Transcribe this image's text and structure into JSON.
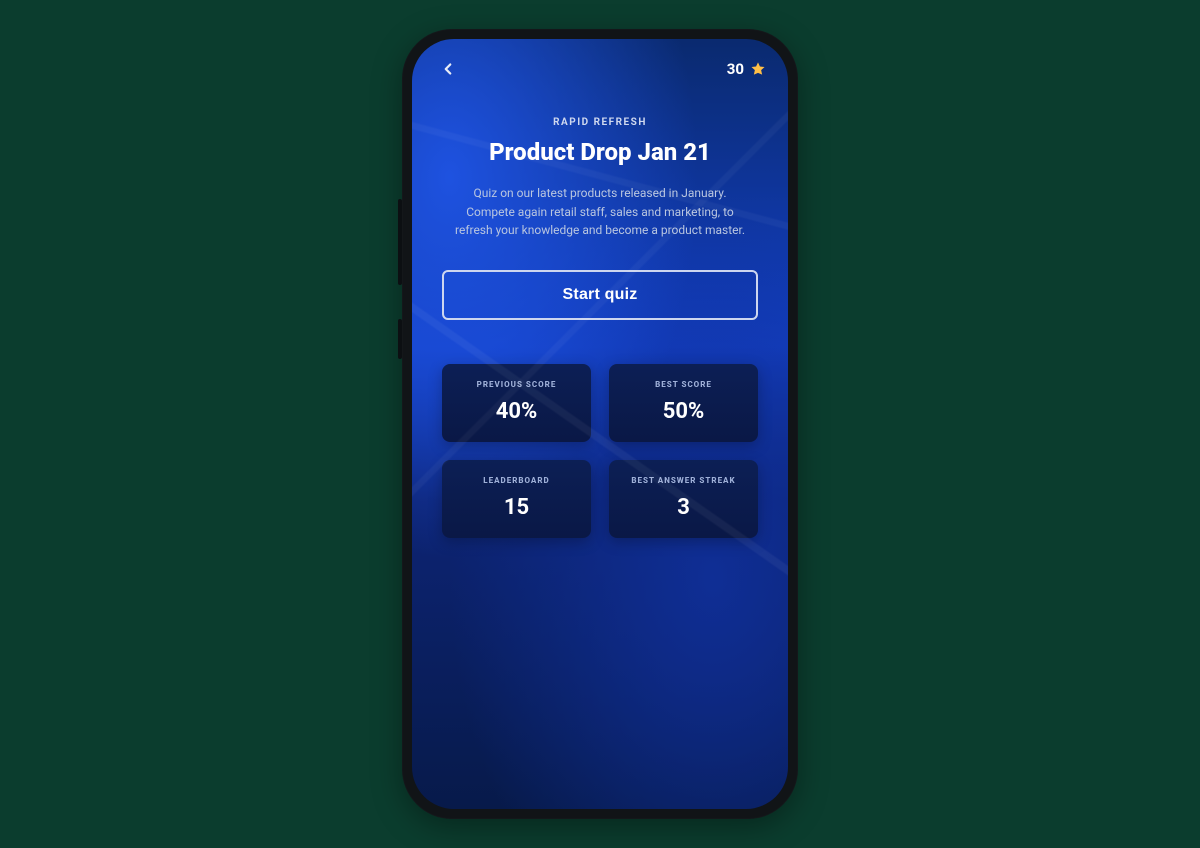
{
  "header": {
    "points": "30"
  },
  "page": {
    "kicker": "RAPID REFRESH",
    "title": "Product Drop Jan 21",
    "description": "Quiz on our latest products released in January. Compete again retail staff, sales and marketing, to refresh your knowledge and become a product master."
  },
  "cta": {
    "label": "Start quiz"
  },
  "stats": {
    "previous_score": {
      "caption": "PREVIOUS SCORE",
      "value": "40%"
    },
    "best_score": {
      "caption": "BEST SCORE",
      "value": "50%"
    },
    "leaderboard": {
      "caption": "LEADERBOARD",
      "value": "15"
    },
    "best_streak": {
      "caption": "BEST ANSWER STREAK",
      "value": "3"
    }
  }
}
